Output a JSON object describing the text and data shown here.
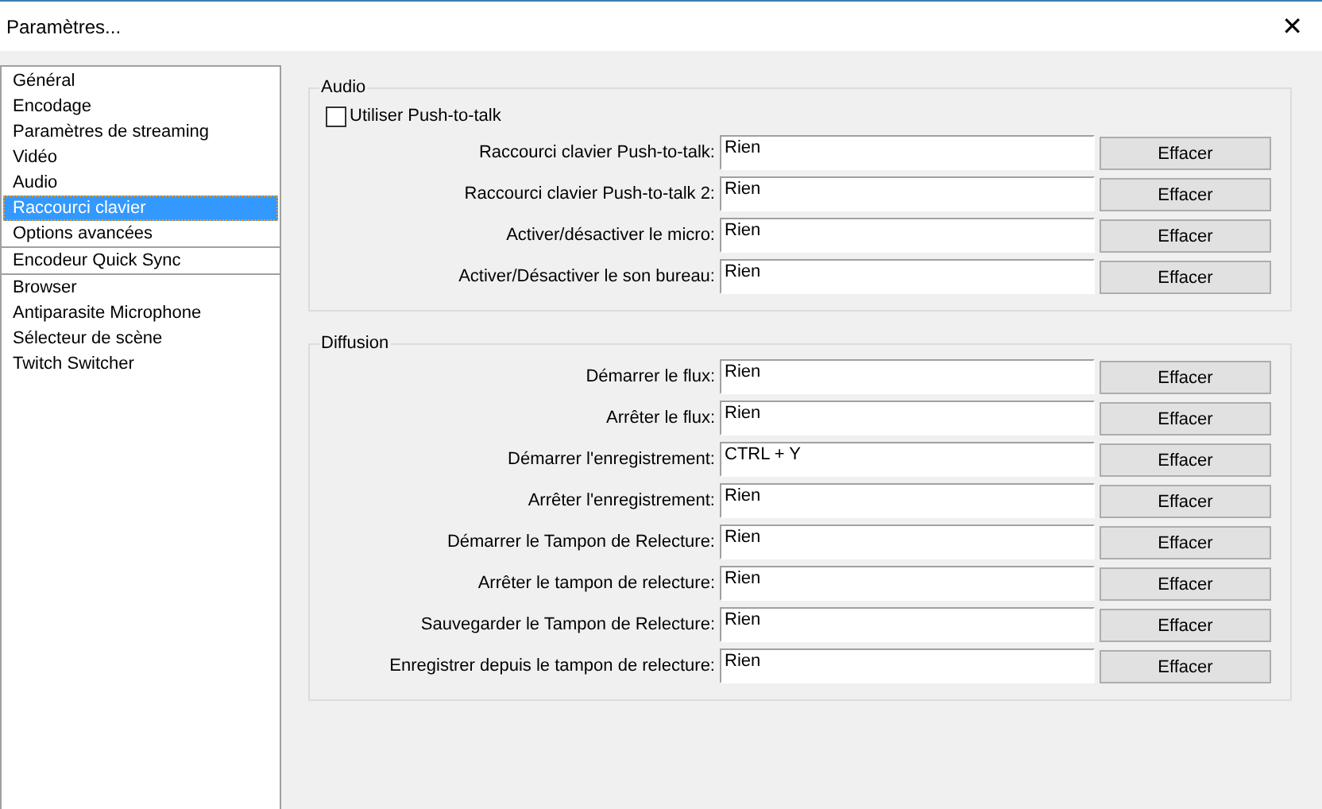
{
  "window": {
    "title": "Paramètres...",
    "close": "✕"
  },
  "sidebar": {
    "sections": [
      {
        "items": [
          {
            "label": "Général",
            "selected": false
          },
          {
            "label": "Encodage",
            "selected": false
          },
          {
            "label": "Paramètres de streaming",
            "selected": false
          },
          {
            "label": "Vidéo",
            "selected": false
          },
          {
            "label": "Audio",
            "selected": false
          },
          {
            "label": "Raccourci clavier",
            "selected": true
          },
          {
            "label": "Options avancées",
            "selected": false
          }
        ]
      },
      {
        "items": [
          {
            "label": "Encodeur Quick Sync",
            "selected": false
          }
        ]
      },
      {
        "items": [
          {
            "label": "Browser",
            "selected": false
          },
          {
            "label": "Antiparasite Microphone",
            "selected": false
          },
          {
            "label": "Sélecteur de scène",
            "selected": false
          },
          {
            "label": "Twitch Switcher",
            "selected": false
          }
        ]
      }
    ]
  },
  "groups": [
    {
      "title": "Audio",
      "checkbox": {
        "label": "Utiliser Push-to-talk",
        "checked": false
      },
      "rows": [
        {
          "label": "Raccourci clavier Push-to-talk:",
          "value": "Rien",
          "button": "Effacer"
        },
        {
          "label": "Raccourci clavier Push-to-talk 2:",
          "value": "Rien",
          "button": "Effacer"
        },
        {
          "label": "Activer/désactiver le micro:",
          "value": "Rien",
          "button": "Effacer"
        },
        {
          "label": "Activer/Désactiver le son bureau:",
          "value": "Rien",
          "button": "Effacer"
        }
      ]
    },
    {
      "title": "Diffusion",
      "rows": [
        {
          "label": "Démarrer le flux:",
          "value": "Rien",
          "button": "Effacer"
        },
        {
          "label": "Arrêter le flux:",
          "value": "Rien",
          "button": "Effacer"
        },
        {
          "label": "Démarrer l'enregistrement:",
          "value": "CTRL + Y",
          "button": "Effacer"
        },
        {
          "label": "Arrêter l'enregistrement:",
          "value": "Rien",
          "button": "Effacer"
        },
        {
          "label": "Démarrer le Tampon de Relecture:",
          "value": "Rien",
          "button": "Effacer"
        },
        {
          "label": "Arrêter le tampon de relecture:",
          "value": "Rien",
          "button": "Effacer"
        },
        {
          "label": "Sauvegarder le Tampon de Relecture:",
          "value": "Rien",
          "button": "Effacer"
        },
        {
          "label": "Enregistrer depuis le tampon de relecture:",
          "value": "Rien",
          "button": "Effacer"
        }
      ]
    }
  ]
}
